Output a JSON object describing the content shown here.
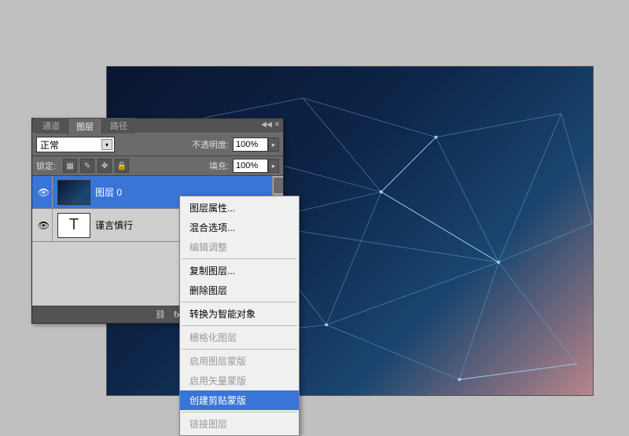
{
  "tabs": {
    "channels": "通道",
    "layers": "图层",
    "paths": "路径"
  },
  "blend": {
    "mode": "正常"
  },
  "opacity": {
    "label": "不透明度:",
    "value": "100%"
  },
  "lock": {
    "label": "锁定:"
  },
  "fill": {
    "label": "填充:",
    "value": "100%"
  },
  "layers_list": [
    {
      "name": "图层 0"
    },
    {
      "name": "谨言慎行"
    }
  ],
  "thumb_text": "T",
  "context_menu": {
    "items": [
      {
        "label": "图层属性...",
        "enabled": true
      },
      {
        "label": "混合选项...",
        "enabled": true
      },
      {
        "label": "编辑调整",
        "enabled": false
      },
      {
        "sep": true
      },
      {
        "label": "复制图层...",
        "enabled": true
      },
      {
        "label": "删除图层",
        "enabled": true
      },
      {
        "sep": true
      },
      {
        "label": "转换为智能对象",
        "enabled": true
      },
      {
        "sep": true
      },
      {
        "label": "栅格化图层",
        "enabled": false
      },
      {
        "sep": true
      },
      {
        "label": "启用图层蒙版",
        "enabled": false
      },
      {
        "label": "启用矢量蒙版",
        "enabled": false
      },
      {
        "label": "创建剪贴蒙版",
        "enabled": true,
        "highlighted": true
      },
      {
        "sep": true
      },
      {
        "label": "链接图层",
        "enabled": false
      }
    ]
  }
}
